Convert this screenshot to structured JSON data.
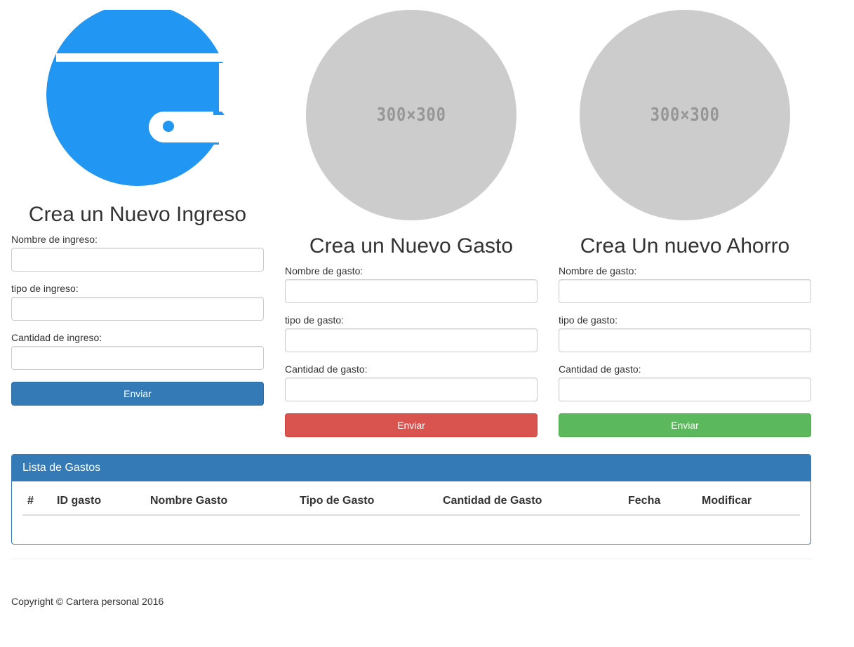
{
  "forms": [
    {
      "title": "Crea un Nuevo Ingreso",
      "image": "wallet-icon",
      "fields": [
        {
          "label": "Nombre de ingreso:",
          "value": "",
          "placeholder": ""
        },
        {
          "label": "tipo de ingreso:",
          "value": "",
          "placeholder": ""
        },
        {
          "label": "Cantidad de ingreso:",
          "value": "",
          "placeholder": ""
        }
      ],
      "submit_label": "Enviar",
      "button_color": "#337ab7"
    },
    {
      "title": "Crea un Nuevo Gasto",
      "image_text": "300×300",
      "fields": [
        {
          "label": "Nombre de gasto:",
          "value": "",
          "placeholder": ""
        },
        {
          "label": "tipo de gasto:",
          "value": "",
          "placeholder": ""
        },
        {
          "label": "Cantidad de gasto:",
          "value": "",
          "placeholder": ""
        }
      ],
      "submit_label": "Enviar",
      "button_color": "#d9534f"
    },
    {
      "title": "Crea Un nuevo Ahorro",
      "image_text": "300×300",
      "fields": [
        {
          "label": "Nombre de gasto:",
          "value": "",
          "placeholder": ""
        },
        {
          "label": "tipo de gasto:",
          "value": "",
          "placeholder": ""
        },
        {
          "label": "Cantidad de gasto:",
          "value": "",
          "placeholder": ""
        }
      ],
      "submit_label": "Enviar",
      "button_color": "#5cb85c"
    }
  ],
  "expenses_panel": {
    "title": "Lista de Gastos",
    "columns": [
      "#",
      "ID gasto",
      "Nombre Gasto",
      "Tipo de Gasto",
      "Cantidad de Gasto",
      "Fecha",
      "Modificar"
    ],
    "rows": []
  },
  "footer": {
    "copyright": "Copyright © Cartera personal 2016"
  },
  "colors": {
    "primary": "#337ab7",
    "danger": "#d9534f",
    "success": "#5cb85c",
    "wallet": "#2196f3",
    "placeholder_bg": "#cccccc"
  }
}
